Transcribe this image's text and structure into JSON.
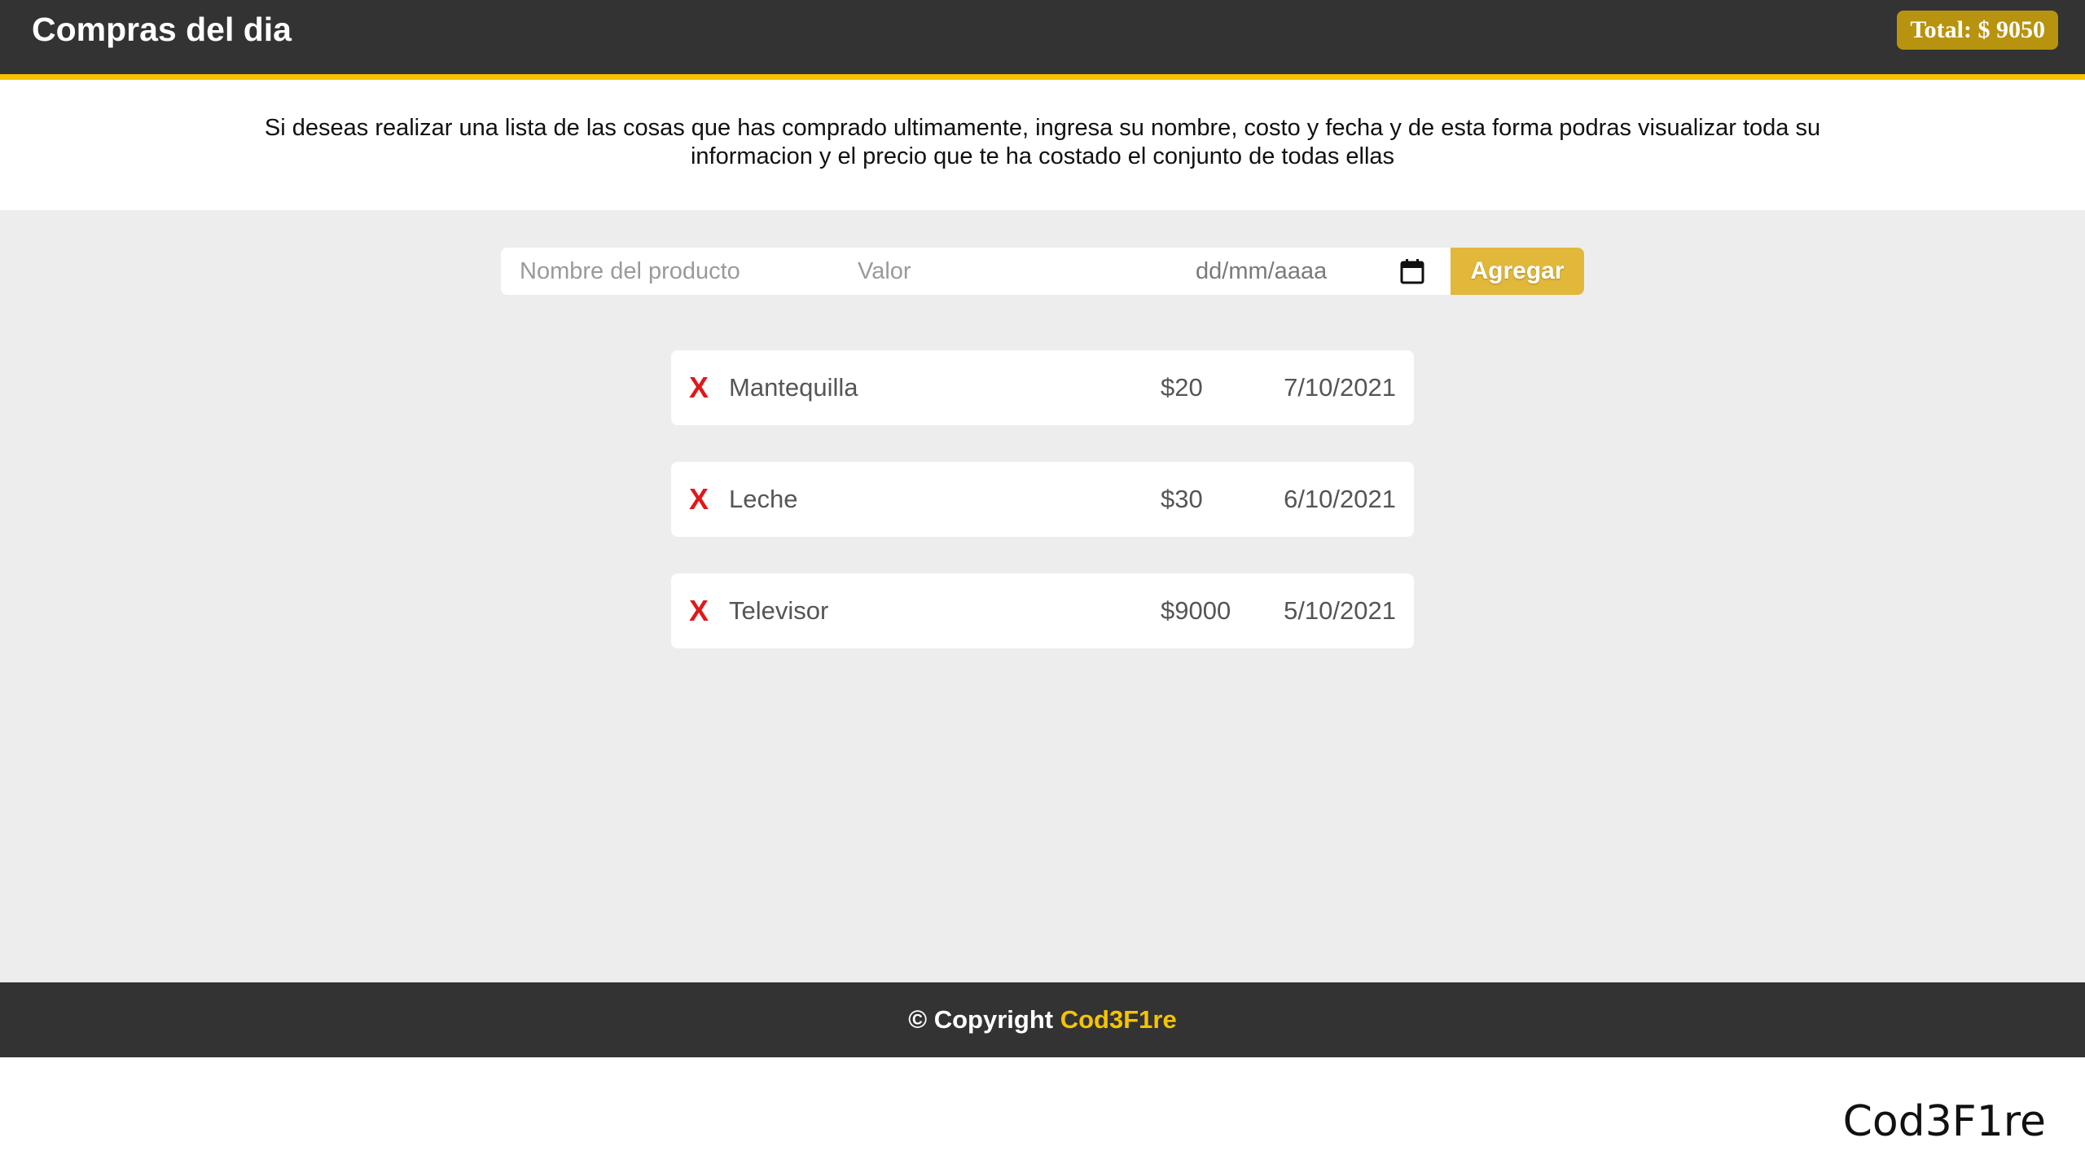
{
  "header": {
    "title": "Compras del dia",
    "total_label": "Total: $ 9050"
  },
  "intro": {
    "text": "Si deseas realizar una lista de las cosas que has comprado ultimamente, ingresa su nombre, costo y fecha y de esta forma podras visualizar toda su informacion y el precio que te ha costado el conjunto de todas ellas"
  },
  "form": {
    "name_placeholder": "Nombre del producto",
    "value_placeholder": "Valor",
    "date_placeholder": "dd/mm/aaaa",
    "date_icon": "calendar-icon",
    "add_label": "Agregar"
  },
  "items": [
    {
      "delete_label": "X",
      "name": "Mantequilla",
      "price": "$20",
      "date": "7/10/2021"
    },
    {
      "delete_label": "X",
      "name": "Leche",
      "price": "$30",
      "date": "6/10/2021"
    },
    {
      "delete_label": "X",
      "name": "Televisor",
      "price": "$9000",
      "date": "5/10/2021"
    }
  ],
  "footer": {
    "copyright_prefix": "© Copyright ",
    "brand": "Cod3F1re"
  },
  "watermark": "Cod3F1re",
  "colors": {
    "header_bg": "#333333",
    "accent": "#f5c400",
    "total_badge": "#b8930f",
    "button": "#e2b83a",
    "delete": "#e0181b",
    "main_bg": "#ededed"
  }
}
